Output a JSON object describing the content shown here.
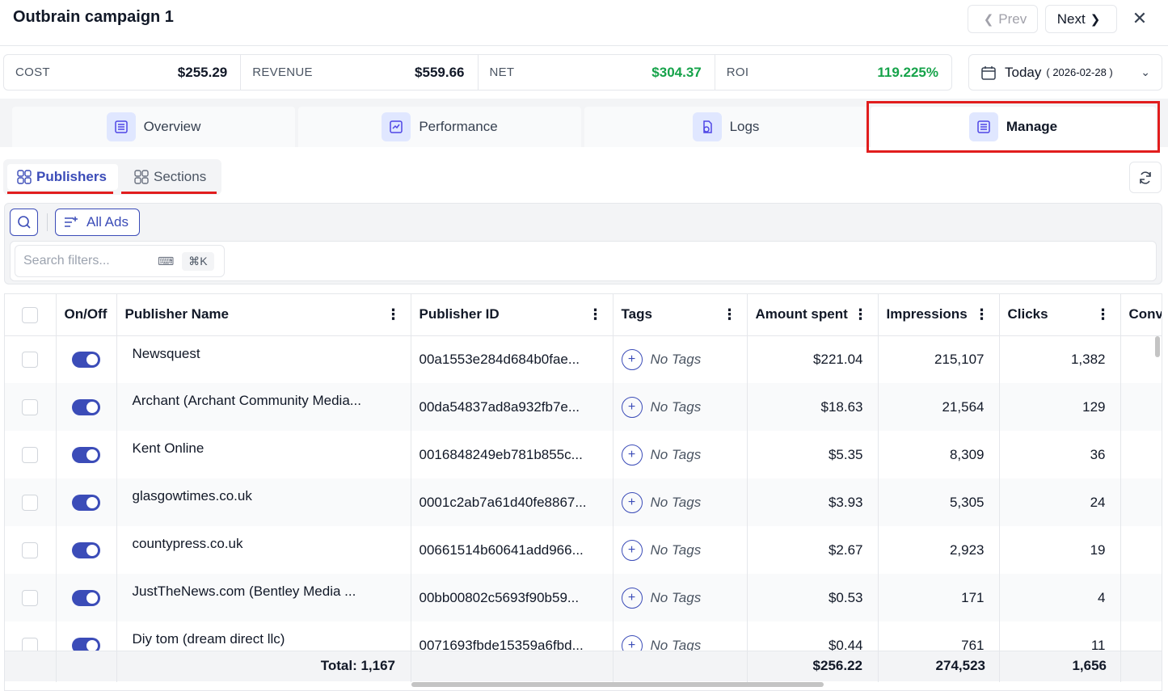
{
  "header": {
    "title": "Outbrain campaign 1",
    "prev_label": "Prev",
    "next_label": "Next"
  },
  "stats": [
    {
      "label": "COST",
      "value": "$255.29",
      "positive": false
    },
    {
      "label": "REVENUE",
      "value": "$559.66",
      "positive": false
    },
    {
      "label": "NET",
      "value": "$304.37",
      "positive": true
    },
    {
      "label": "ROI",
      "value": "119.225%",
      "positive": true
    }
  ],
  "date": {
    "main": "Today",
    "sub": "( 2026-02-28 )"
  },
  "tabs": [
    {
      "label": "Overview",
      "icon": "list-icon"
    },
    {
      "label": "Performance",
      "icon": "chart-icon"
    },
    {
      "label": "Logs",
      "icon": "logs-icon"
    },
    {
      "label": "Manage",
      "icon": "list-icon"
    }
  ],
  "subtabs": {
    "publishers": "Publishers",
    "sections": "Sections"
  },
  "filters": {
    "all_ads": "All Ads",
    "search_placeholder": "Search filters...",
    "shortcut": "⌘K"
  },
  "table": {
    "columns": [
      "On/Off",
      "Publisher Name",
      "Publisher ID",
      "Tags",
      "Amount spent",
      "Impressions",
      "Clicks",
      "Conv"
    ],
    "rows": [
      {
        "name": "Newsquest",
        "id": "00a1553e284d684b0fae...",
        "tags": "No Tags",
        "amount": "$221.04",
        "impressions": "215,107",
        "clicks": "1,382"
      },
      {
        "name": "Archant (Archant Community Media...",
        "id": "00da54837ad8a932fb7e...",
        "tags": "No Tags",
        "amount": "$18.63",
        "impressions": "21,564",
        "clicks": "129"
      },
      {
        "name": "Kent Online",
        "id": "0016848249eb781b855c...",
        "tags": "No Tags",
        "amount": "$5.35",
        "impressions": "8,309",
        "clicks": "36"
      },
      {
        "name": "glasgowtimes.co.uk",
        "id": "0001c2ab7a61d40fe8867...",
        "tags": "No Tags",
        "amount": "$3.93",
        "impressions": "5,305",
        "clicks": "24"
      },
      {
        "name": "countypress.co.uk",
        "id": "00661514b60641add966...",
        "tags": "No Tags",
        "amount": "$2.67",
        "impressions": "2,923",
        "clicks": "19"
      },
      {
        "name": "JustTheNews.com (Bentley Media ...",
        "id": "00bb00802c5693f90b59...",
        "tags": "No Tags",
        "amount": "$0.53",
        "impressions": "171",
        "clicks": "4"
      },
      {
        "name": "Diy tom (dream direct llc)",
        "id": "0071693fbde15359a6fbd...",
        "tags": "No Tags",
        "amount": "$0.44",
        "impressions": "761",
        "clicks": "11"
      }
    ],
    "totals": {
      "label": "Total: 1,167",
      "amount": "$256.22",
      "impressions": "274,523",
      "clicks": "1,656"
    }
  },
  "colors": {
    "accent": "#3b4cb8",
    "positive": "#16a34a",
    "highlight": "#e11d1d"
  }
}
